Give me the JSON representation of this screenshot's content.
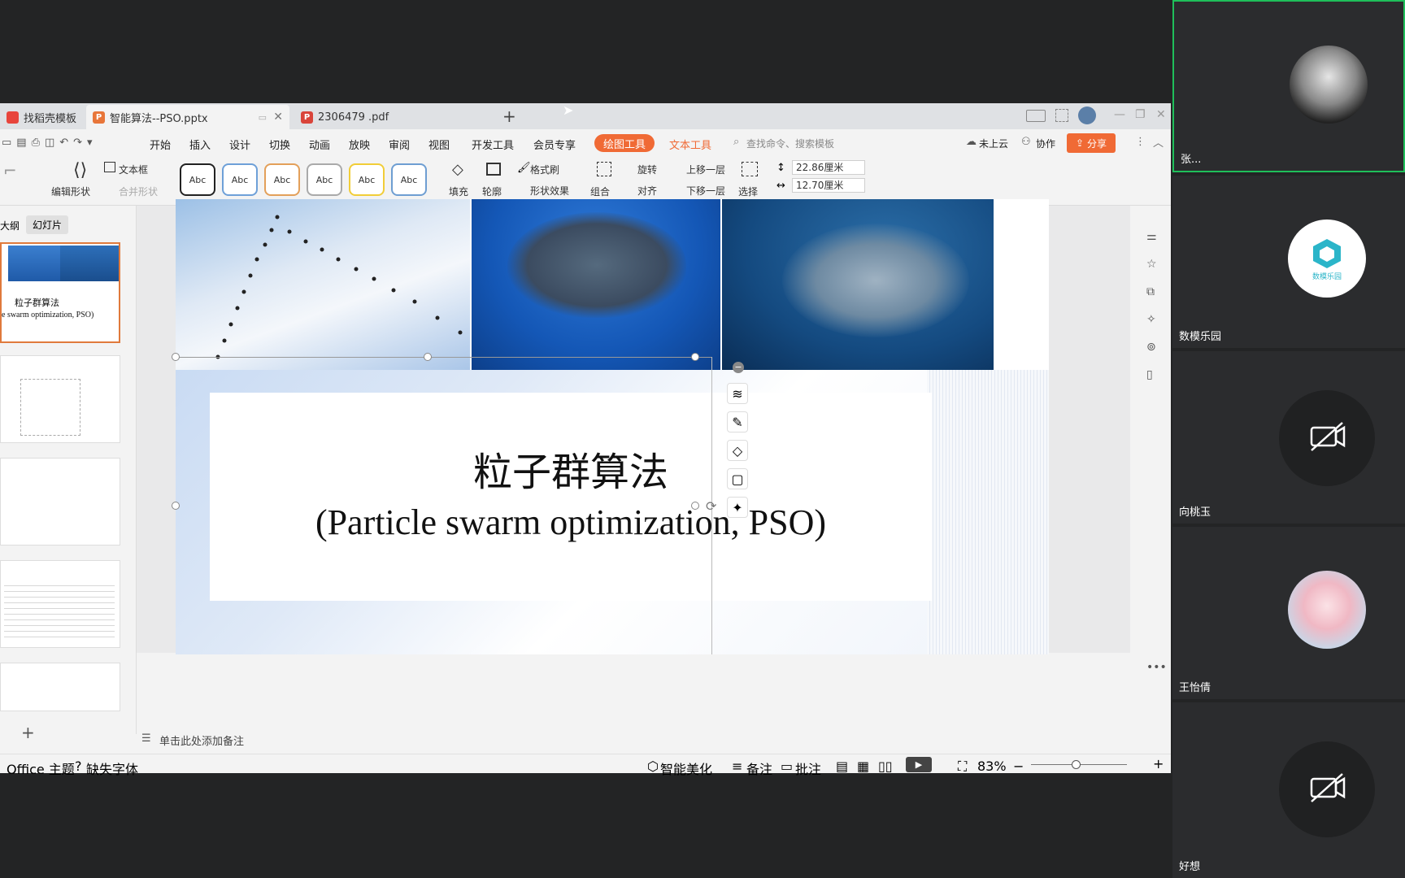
{
  "tabs": [
    {
      "label": "找稻壳模板"
    },
    {
      "label": "智能算法--PSO.pptx"
    },
    {
      "label": "2306479 .pdf"
    }
  ],
  "new_tab": "+",
  "menu": {
    "items": [
      "开始",
      "插入",
      "设计",
      "切换",
      "动画",
      "放映",
      "审阅",
      "视图",
      "开发工具",
      "会员专享"
    ],
    "drawing_tools": "绘图工具",
    "text_tools": "文本工具",
    "search_placeholder": "查找命令、搜索模板",
    "cloud": "未上云",
    "collab": "协作",
    "share": "分享"
  },
  "ribbon": {
    "edit_shape": "编辑形状",
    "textbox": "文本框",
    "merge_shape": "合并形状",
    "style_label": "Abc",
    "fill": "填充",
    "outline": "轮廓",
    "format_painter": "格式刷",
    "shape_effect": "形状效果",
    "group": "组合",
    "rotate": "旋转",
    "align": "对齐",
    "bring_forward": "上移一层",
    "send_backward": "下移一层",
    "select": "选择",
    "height": "22.86厘米",
    "width": "12.70厘米"
  },
  "left_pane": {
    "tab_outline": "大纲",
    "tab_slides": "幻灯片",
    "thumb1_title": "粒子群算法",
    "thumb1_sub": "e swarm optimization, PSO)"
  },
  "slide": {
    "title": "粒子群算法",
    "subtitle": "(Particle swarm optimization, PSO)"
  },
  "notes_placeholder": "单击此处添加备注",
  "status": {
    "theme": "Office 主题",
    "missing_font": "缺失字体",
    "beautify": "智能美化",
    "notes": "备注",
    "comments": "批注",
    "zoom": "83%"
  },
  "participants": [
    {
      "name": "张..."
    },
    {
      "name": "数模乐园",
      "logo_text": "数模乐园"
    },
    {
      "name": "向桃玉"
    },
    {
      "name": "王怡倩"
    },
    {
      "name": "好想"
    }
  ],
  "colors": {
    "accent_orange": "#f06a35",
    "drawing_tools_bg": "#f06a35",
    "active_speaker_border": "#1fbf5a",
    "slide_blue": "#c9dbf3"
  }
}
